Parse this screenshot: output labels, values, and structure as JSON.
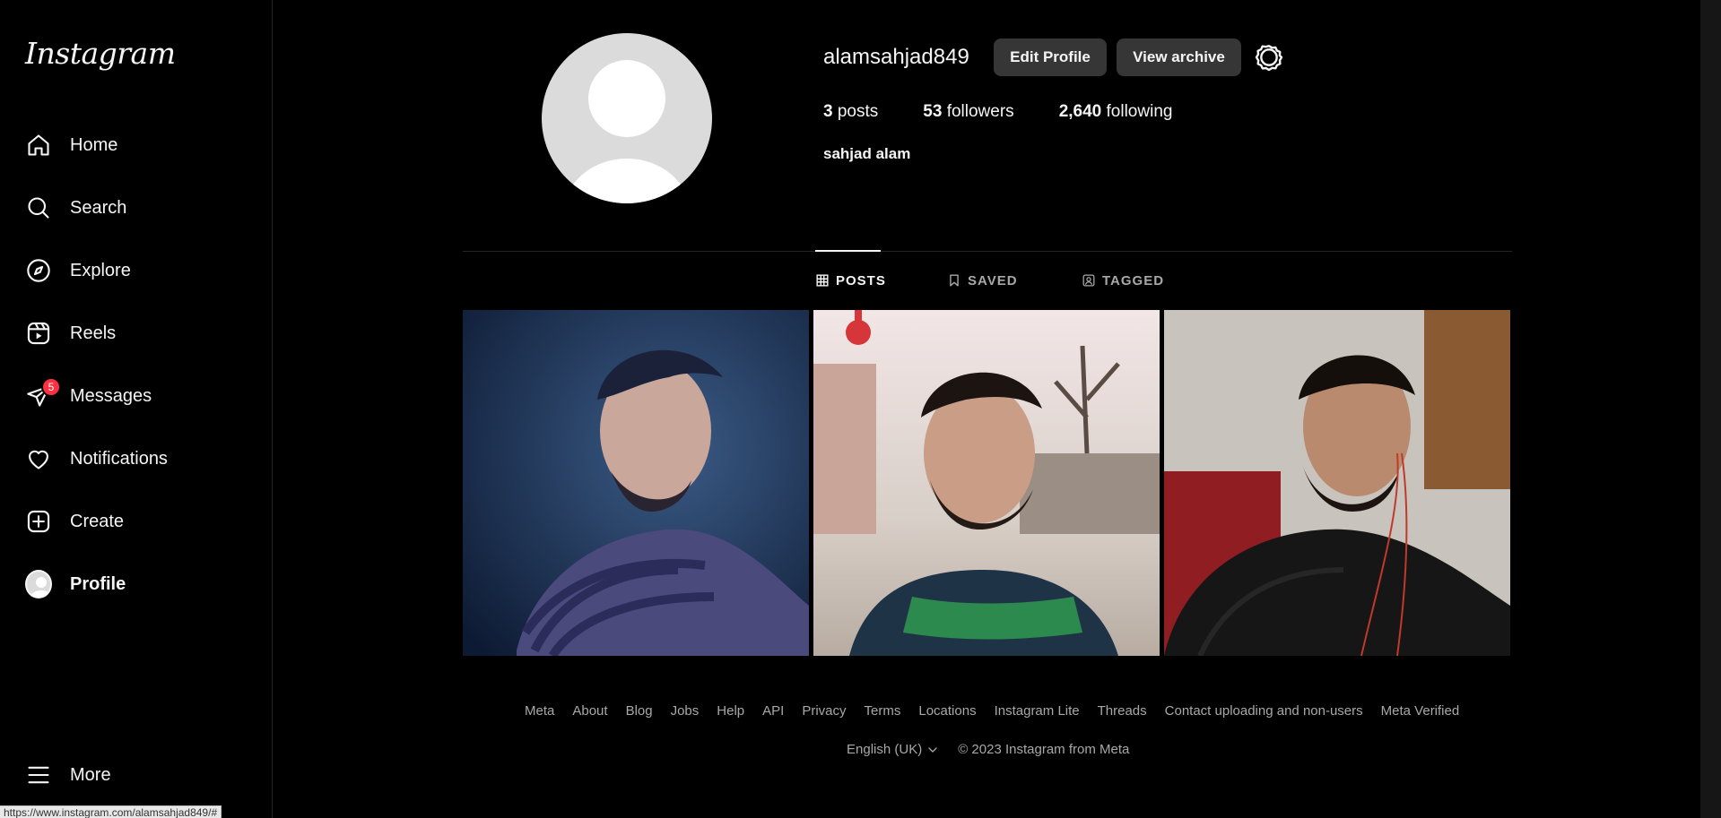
{
  "brand": {
    "logo_text": "Instagram"
  },
  "sidebar": {
    "items": [
      {
        "label": "Home",
        "icon": "home-icon"
      },
      {
        "label": "Search",
        "icon": "search-icon"
      },
      {
        "label": "Explore",
        "icon": "compass-icon"
      },
      {
        "label": "Reels",
        "icon": "reels-icon"
      },
      {
        "label": "Messages",
        "icon": "messenger-icon",
        "badge": "5"
      },
      {
        "label": "Notifications",
        "icon": "heart-icon"
      },
      {
        "label": "Create",
        "icon": "plus-square-icon"
      },
      {
        "label": "Profile",
        "icon": "profile-avatar"
      }
    ],
    "more_label": "More"
  },
  "profile": {
    "username": "alamsahjad849",
    "edit_label": "Edit Profile",
    "archive_label": "View archive",
    "posts_count": "3",
    "posts_label": "posts",
    "followers_count": "53",
    "followers_label": "followers",
    "following_count": "2,640",
    "following_label": "following",
    "full_name": "sahjad alam"
  },
  "tabs": [
    {
      "label": "POSTS",
      "active": true
    },
    {
      "label": "SAVED",
      "active": false
    },
    {
      "label": "TAGGED",
      "active": false
    }
  ],
  "footer": {
    "links": [
      "Meta",
      "About",
      "Blog",
      "Jobs",
      "Help",
      "API",
      "Privacy",
      "Terms",
      "Locations",
      "Instagram Lite",
      "Threads",
      "Contact uploading and non-users",
      "Meta Verified"
    ],
    "language": "English (UK)",
    "copyright": "© 2023 Instagram from Meta"
  },
  "status_bar": {
    "url": "https://www.instagram.com/alamsahjad849/#"
  },
  "colors": {
    "background": "#000000",
    "button": "#363636",
    "badge": "#ff3040",
    "muted_text": "#a8a8a8"
  }
}
